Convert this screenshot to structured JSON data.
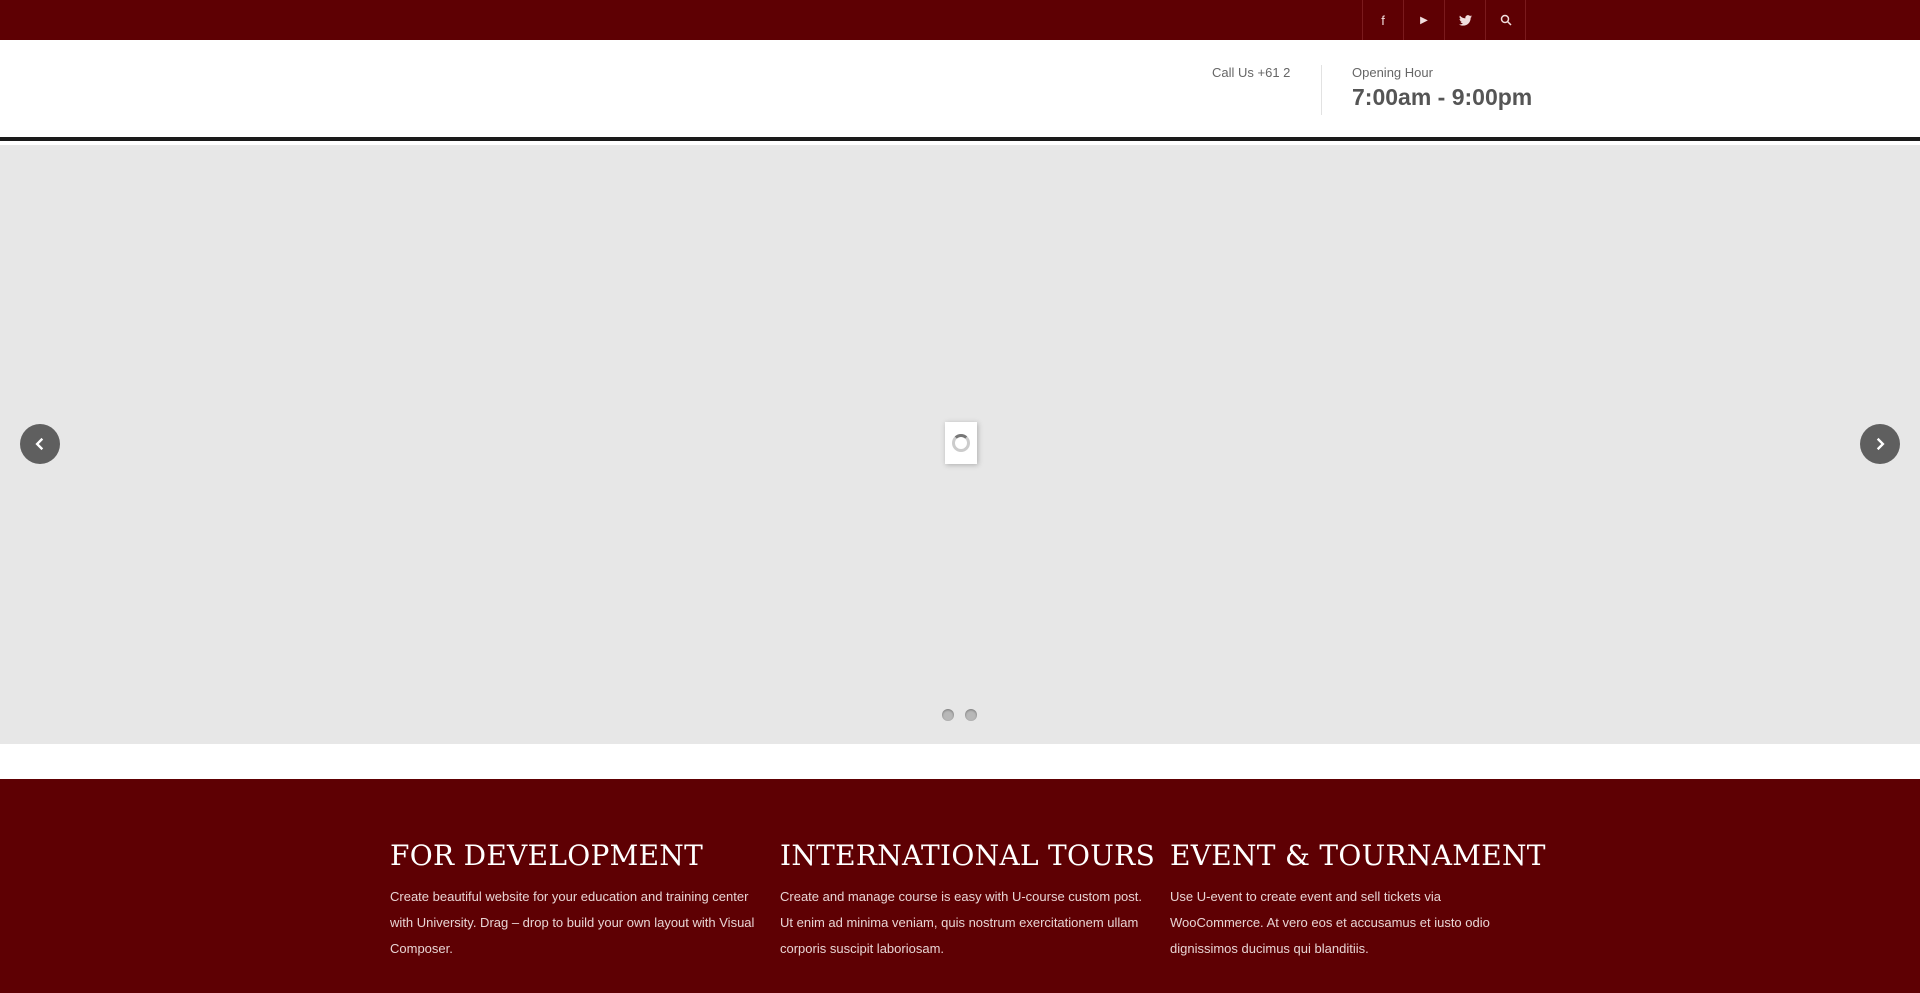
{
  "topbar": {
    "social": [
      {
        "icon": "facebook-icon",
        "glyph": "f"
      },
      {
        "icon": "youtube-icon",
        "glyph": "▶"
      },
      {
        "icon": "twitter-icon",
        "glyph": "🐦"
      },
      {
        "icon": "search-icon",
        "glyph": "⚲"
      }
    ],
    "color": "#5e0003"
  },
  "header": {
    "call_us": "Call Us +61 2",
    "opening_hour_label": "Opening Hour",
    "opening_hour_value": "7:00am - 9:00pm"
  },
  "slider": {
    "prev_glyph": "‹",
    "next_glyph": "›",
    "slides_count": 2
  },
  "features": [
    {
      "title": "FOR DEVELOPMENT",
      "text": "Create beautiful website for your education and training center with University. Drag – drop to build your own layout with Visual Composer."
    },
    {
      "title": "INTERNATIONAL TOURS",
      "text": "Create and manage course is easy with U-course custom post. Ut enim ad minima veniam, quis nostrum exercitationem ullam corporis suscipit laboriosam."
    },
    {
      "title": "EVENT & TOURNAMENT",
      "text": "Use U-event to create event and sell tickets via WooCommerce. At vero eos et accusamus et iusto odio dignissimos ducimus qui blanditiis."
    }
  ]
}
